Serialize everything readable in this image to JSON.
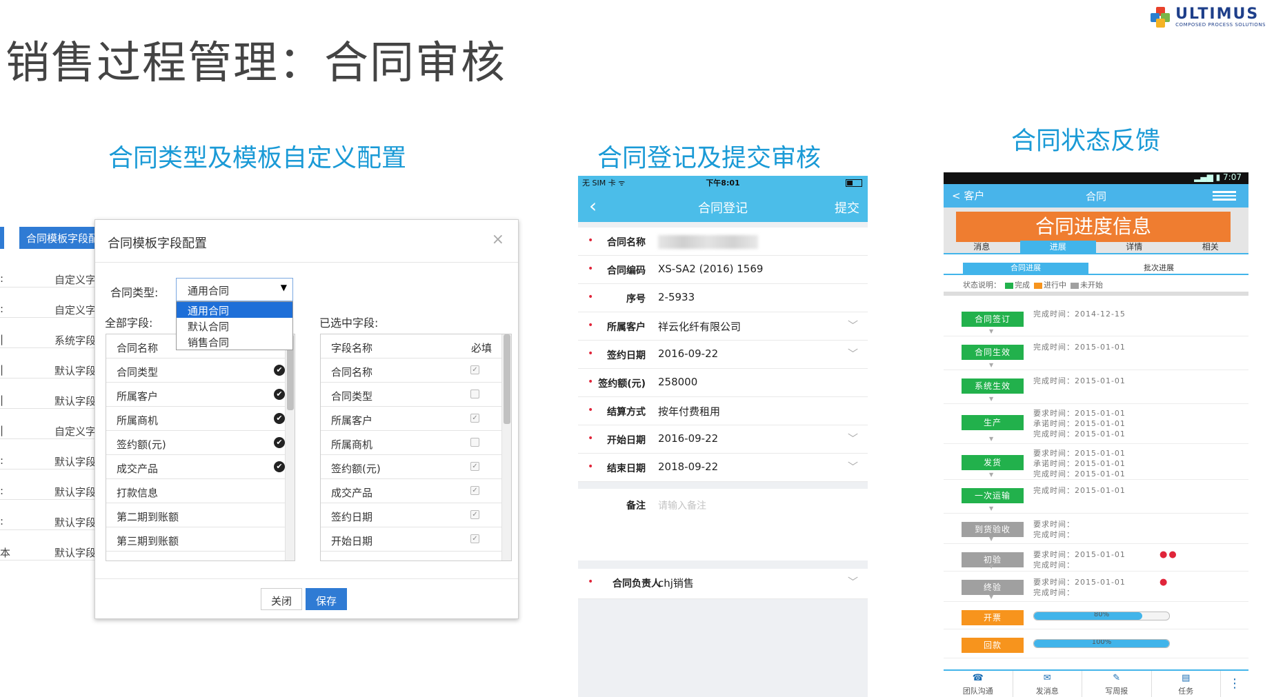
{
  "slide": {
    "title": "销售过程管理：合同审核"
  },
  "logo": {
    "brand": "ULTIMUS",
    "tagline": "COMPOSED PROCESS SOLUTIONS",
    "colors": [
      "#e8412b",
      "#2b7fcf",
      "#7ab648",
      "#f5b324"
    ]
  },
  "sections": {
    "config": "合同类型及模板自定义配置",
    "register": "合同登记及提交审核",
    "status": "合同状态反馈"
  },
  "background_table": {
    "tab_label": "合同模板字段配",
    "rows": [
      {
        "c1": ":",
        "c2": "自定义字"
      },
      {
        "c1": ":",
        "c2": "自定义字"
      },
      {
        "c1": "|",
        "c2": "系统字段"
      },
      {
        "c1": "|",
        "c2": "默认字段"
      },
      {
        "c1": "|",
        "c2": "默认字段"
      },
      {
        "c1": "|",
        "c2": "自定义字"
      },
      {
        "c1": ":",
        "c2": "默认字段"
      },
      {
        "c1": ":",
        "c2": "默认字段"
      },
      {
        "c1": ":",
        "c2": "默认字段"
      },
      {
        "c1": "本",
        "c2": "默认字段"
      }
    ]
  },
  "dialog": {
    "title": "合同模板字段配置",
    "close_glyph": "×",
    "type_label": "合同类型:",
    "type_selected": "通用合同",
    "type_options": [
      "通用合同",
      "默认合同",
      "销售合同"
    ],
    "all_fields_label": "全部字段:",
    "selected_fields_label": "已选中字段:",
    "all_fields_header": "合同名称",
    "all_fields": [
      {
        "name": "合同类型",
        "selected": true
      },
      {
        "name": "所属客户",
        "selected": true
      },
      {
        "name": "所属商机",
        "selected": true
      },
      {
        "name": "签约额(元)",
        "selected": true
      },
      {
        "name": "成交产品",
        "selected": true
      },
      {
        "name": "打款信息",
        "selected": false
      },
      {
        "name": "第二期到账额",
        "selected": false
      },
      {
        "name": "第三期到账额",
        "selected": false
      }
    ],
    "selected_header": {
      "name": "字段名称",
      "required": "必填"
    },
    "selected_fields": [
      {
        "name": "合同名称",
        "required": true
      },
      {
        "name": "合同类型",
        "required": false
      },
      {
        "name": "所属客户",
        "required": true
      },
      {
        "name": "所属商机",
        "required": false
      },
      {
        "name": "签约额(元)",
        "required": true
      },
      {
        "name": "成交产品",
        "required": true
      },
      {
        "name": "签约日期",
        "required": true
      },
      {
        "name": "开始日期",
        "required": true
      }
    ],
    "close_button": "关闭",
    "save_button": "保存"
  },
  "phone_ios": {
    "carrier": "无 SIM 卡 ᯤ",
    "time": "下午8:01",
    "nav_title": "合同登记",
    "nav_back": "‹",
    "nav_submit": "提交",
    "fields": [
      {
        "label": "合同名称",
        "value": "",
        "blurred": true,
        "chevron": false
      },
      {
        "label": "合同编码",
        "value": "XS-SA2 (2016) 1569",
        "chevron": false
      },
      {
        "label": "序号",
        "value": "2-5933",
        "chevron": false
      },
      {
        "label": "所属客户",
        "value": "祥云化纤有限公司",
        "chevron": true
      },
      {
        "label": "签约日期",
        "value": "2016-09-22",
        "chevron": true
      },
      {
        "label": "签约额(元)",
        "value": "258000",
        "chevron": false
      },
      {
        "label": "结算方式",
        "value": "按年付费租用",
        "chevron": false
      },
      {
        "label": "开始日期",
        "value": "2016-09-22",
        "chevron": true
      },
      {
        "label": "结束日期",
        "value": "2018-09-22",
        "chevron": true
      }
    ],
    "notes_label": "备注",
    "notes_placeholder": "请输入备注",
    "owner_label": "合同负责人",
    "owner_value": "chj销售"
  },
  "phone_android": {
    "time": "7:07",
    "nav_back": "< 客户",
    "nav_title": "合同",
    "banner": "合同进度信息",
    "tabs": [
      "消息",
      "进展",
      "详情",
      "相关"
    ],
    "active_tab": 1,
    "subtabs": [
      "合同进展",
      "批次进展"
    ],
    "legend_prefix": "状态说明：",
    "legend": [
      {
        "label": "完成",
        "color": "#22b14c"
      },
      {
        "label": "进行中",
        "color": "#f7941d"
      },
      {
        "label": "未开始",
        "color": "#a0a0a0"
      }
    ],
    "stages": [
      {
        "name": "合同签订",
        "color": "#22b14c",
        "lines": [
          "完成时间：2014-12-15"
        ]
      },
      {
        "name": "合同生效",
        "color": "#22b14c",
        "lines": [
          "完成时间：2015-01-01"
        ]
      },
      {
        "name": "系统生效",
        "color": "#22b14c",
        "lines": [
          "完成时间：2015-01-01"
        ]
      },
      {
        "name": "生产",
        "color": "#22b14c",
        "lines": [
          "要求时间：2015-01-01",
          "承诺时间：2015-01-01",
          "完成时间：2015-01-01"
        ]
      },
      {
        "name": "发货",
        "color": "#22b14c",
        "lines": [
          "要求时间：2015-01-01",
          "承诺时间：2015-01-01",
          "完成时间：2015-01-01"
        ]
      },
      {
        "name": "一次运输",
        "color": "#22b14c",
        "lines": [
          "完成时间：2015-01-01"
        ]
      },
      {
        "name": "到货验收",
        "color": "#a0a0a0",
        "lines": [
          "要求时间：",
          "完成时间："
        ]
      },
      {
        "name": "初验",
        "color": "#a0a0a0",
        "lines": [
          "要求时间：2015-01-01",
          "完成时间："
        ],
        "flags": 2
      },
      {
        "name": "终验",
        "color": "#a0a0a0",
        "lines": [
          "要求时间：2015-01-01",
          "完成时间："
        ],
        "flags": 1
      },
      {
        "name": "开票",
        "color": "#f7941d",
        "progress": 80,
        "progress_label": "80%"
      },
      {
        "name": "回款",
        "color": "#f7941d",
        "progress": 100,
        "progress_label": "100%"
      }
    ],
    "bottom_tabs": [
      "团队沟通",
      "发消息",
      "写周报",
      "任务"
    ],
    "more_glyph": "⋮"
  }
}
